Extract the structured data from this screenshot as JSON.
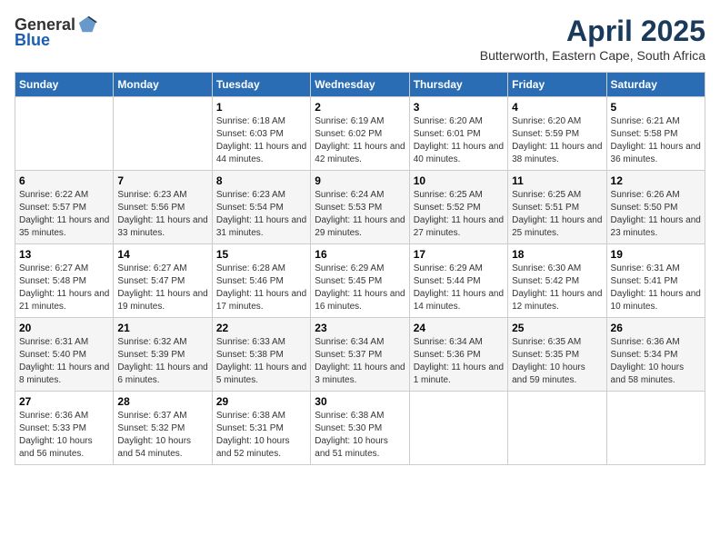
{
  "logo": {
    "general": "General",
    "blue": "Blue"
  },
  "title": "April 2025",
  "location": "Butterworth, Eastern Cape, South Africa",
  "weekdays": [
    "Sunday",
    "Monday",
    "Tuesday",
    "Wednesday",
    "Thursday",
    "Friday",
    "Saturday"
  ],
  "weeks": [
    [
      {
        "day": "",
        "sunrise": "",
        "sunset": "",
        "daylight": ""
      },
      {
        "day": "",
        "sunrise": "",
        "sunset": "",
        "daylight": ""
      },
      {
        "day": "1",
        "sunrise": "Sunrise: 6:18 AM",
        "sunset": "Sunset: 6:03 PM",
        "daylight": "Daylight: 11 hours and 44 minutes."
      },
      {
        "day": "2",
        "sunrise": "Sunrise: 6:19 AM",
        "sunset": "Sunset: 6:02 PM",
        "daylight": "Daylight: 11 hours and 42 minutes."
      },
      {
        "day": "3",
        "sunrise": "Sunrise: 6:20 AM",
        "sunset": "Sunset: 6:01 PM",
        "daylight": "Daylight: 11 hours and 40 minutes."
      },
      {
        "day": "4",
        "sunrise": "Sunrise: 6:20 AM",
        "sunset": "Sunset: 5:59 PM",
        "daylight": "Daylight: 11 hours and 38 minutes."
      },
      {
        "day": "5",
        "sunrise": "Sunrise: 6:21 AM",
        "sunset": "Sunset: 5:58 PM",
        "daylight": "Daylight: 11 hours and 36 minutes."
      }
    ],
    [
      {
        "day": "6",
        "sunrise": "Sunrise: 6:22 AM",
        "sunset": "Sunset: 5:57 PM",
        "daylight": "Daylight: 11 hours and 35 minutes."
      },
      {
        "day": "7",
        "sunrise": "Sunrise: 6:23 AM",
        "sunset": "Sunset: 5:56 PM",
        "daylight": "Daylight: 11 hours and 33 minutes."
      },
      {
        "day": "8",
        "sunrise": "Sunrise: 6:23 AM",
        "sunset": "Sunset: 5:54 PM",
        "daylight": "Daylight: 11 hours and 31 minutes."
      },
      {
        "day": "9",
        "sunrise": "Sunrise: 6:24 AM",
        "sunset": "Sunset: 5:53 PM",
        "daylight": "Daylight: 11 hours and 29 minutes."
      },
      {
        "day": "10",
        "sunrise": "Sunrise: 6:25 AM",
        "sunset": "Sunset: 5:52 PM",
        "daylight": "Daylight: 11 hours and 27 minutes."
      },
      {
        "day": "11",
        "sunrise": "Sunrise: 6:25 AM",
        "sunset": "Sunset: 5:51 PM",
        "daylight": "Daylight: 11 hours and 25 minutes."
      },
      {
        "day": "12",
        "sunrise": "Sunrise: 6:26 AM",
        "sunset": "Sunset: 5:50 PM",
        "daylight": "Daylight: 11 hours and 23 minutes."
      }
    ],
    [
      {
        "day": "13",
        "sunrise": "Sunrise: 6:27 AM",
        "sunset": "Sunset: 5:48 PM",
        "daylight": "Daylight: 11 hours and 21 minutes."
      },
      {
        "day": "14",
        "sunrise": "Sunrise: 6:27 AM",
        "sunset": "Sunset: 5:47 PM",
        "daylight": "Daylight: 11 hours and 19 minutes."
      },
      {
        "day": "15",
        "sunrise": "Sunrise: 6:28 AM",
        "sunset": "Sunset: 5:46 PM",
        "daylight": "Daylight: 11 hours and 17 minutes."
      },
      {
        "day": "16",
        "sunrise": "Sunrise: 6:29 AM",
        "sunset": "Sunset: 5:45 PM",
        "daylight": "Daylight: 11 hours and 16 minutes."
      },
      {
        "day": "17",
        "sunrise": "Sunrise: 6:29 AM",
        "sunset": "Sunset: 5:44 PM",
        "daylight": "Daylight: 11 hours and 14 minutes."
      },
      {
        "day": "18",
        "sunrise": "Sunrise: 6:30 AM",
        "sunset": "Sunset: 5:42 PM",
        "daylight": "Daylight: 11 hours and 12 minutes."
      },
      {
        "day": "19",
        "sunrise": "Sunrise: 6:31 AM",
        "sunset": "Sunset: 5:41 PM",
        "daylight": "Daylight: 11 hours and 10 minutes."
      }
    ],
    [
      {
        "day": "20",
        "sunrise": "Sunrise: 6:31 AM",
        "sunset": "Sunset: 5:40 PM",
        "daylight": "Daylight: 11 hours and 8 minutes."
      },
      {
        "day": "21",
        "sunrise": "Sunrise: 6:32 AM",
        "sunset": "Sunset: 5:39 PM",
        "daylight": "Daylight: 11 hours and 6 minutes."
      },
      {
        "day": "22",
        "sunrise": "Sunrise: 6:33 AM",
        "sunset": "Sunset: 5:38 PM",
        "daylight": "Daylight: 11 hours and 5 minutes."
      },
      {
        "day": "23",
        "sunrise": "Sunrise: 6:34 AM",
        "sunset": "Sunset: 5:37 PM",
        "daylight": "Daylight: 11 hours and 3 minutes."
      },
      {
        "day": "24",
        "sunrise": "Sunrise: 6:34 AM",
        "sunset": "Sunset: 5:36 PM",
        "daylight": "Daylight: 11 hours and 1 minute."
      },
      {
        "day": "25",
        "sunrise": "Sunrise: 6:35 AM",
        "sunset": "Sunset: 5:35 PM",
        "daylight": "Daylight: 10 hours and 59 minutes."
      },
      {
        "day": "26",
        "sunrise": "Sunrise: 6:36 AM",
        "sunset": "Sunset: 5:34 PM",
        "daylight": "Daylight: 10 hours and 58 minutes."
      }
    ],
    [
      {
        "day": "27",
        "sunrise": "Sunrise: 6:36 AM",
        "sunset": "Sunset: 5:33 PM",
        "daylight": "Daylight: 10 hours and 56 minutes."
      },
      {
        "day": "28",
        "sunrise": "Sunrise: 6:37 AM",
        "sunset": "Sunset: 5:32 PM",
        "daylight": "Daylight: 10 hours and 54 minutes."
      },
      {
        "day": "29",
        "sunrise": "Sunrise: 6:38 AM",
        "sunset": "Sunset: 5:31 PM",
        "daylight": "Daylight: 10 hours and 52 minutes."
      },
      {
        "day": "30",
        "sunrise": "Sunrise: 6:38 AM",
        "sunset": "Sunset: 5:30 PM",
        "daylight": "Daylight: 10 hours and 51 minutes."
      },
      {
        "day": "",
        "sunrise": "",
        "sunset": "",
        "daylight": ""
      },
      {
        "day": "",
        "sunrise": "",
        "sunset": "",
        "daylight": ""
      },
      {
        "day": "",
        "sunrise": "",
        "sunset": "",
        "daylight": ""
      }
    ]
  ]
}
